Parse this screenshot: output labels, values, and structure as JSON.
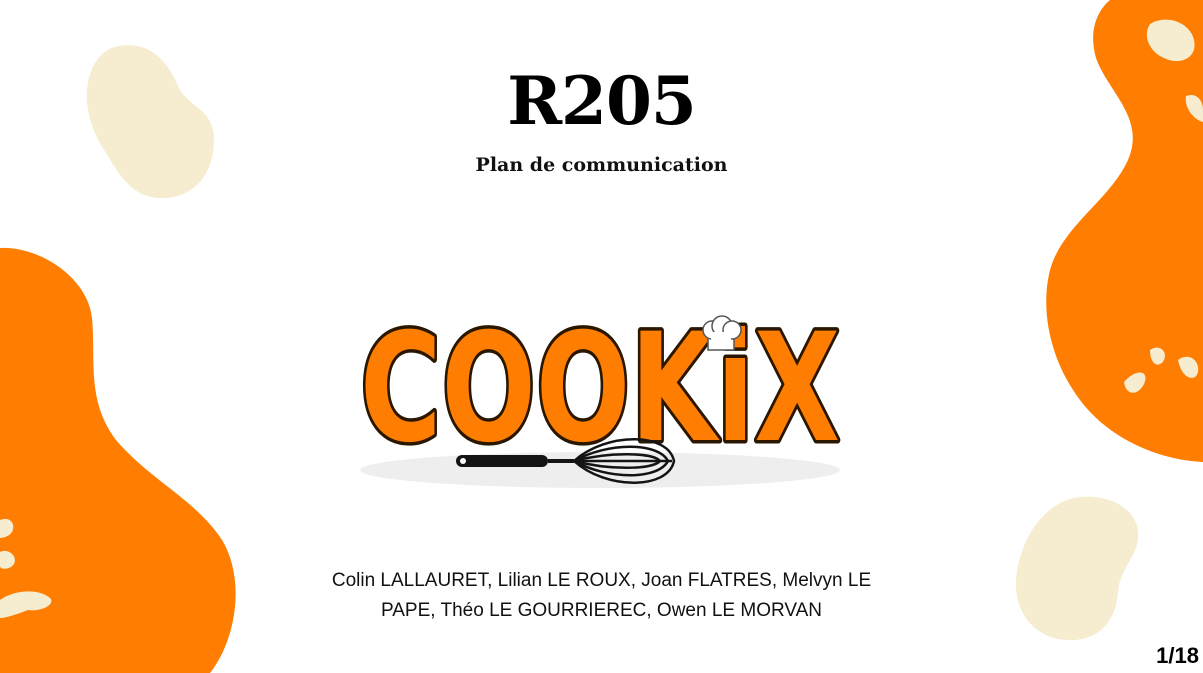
{
  "slide": {
    "title": "R205",
    "subtitle": "Plan de communication",
    "logo": {
      "text": "COOKiX",
      "icons": [
        "chef-hat-icon",
        "whisk-icon"
      ]
    },
    "authors": "Colin LALLAURET, Lilian LE ROUX, Joan FLATRES, Melvyn LE PAPE, Théo LE GOURRIEREC, Owen LE MORVAN",
    "page_number": "1/18"
  },
  "colors": {
    "accent_orange": "#ff7d00",
    "cream": "#f6edd0",
    "background": "#ffffff",
    "text": "#000000"
  }
}
